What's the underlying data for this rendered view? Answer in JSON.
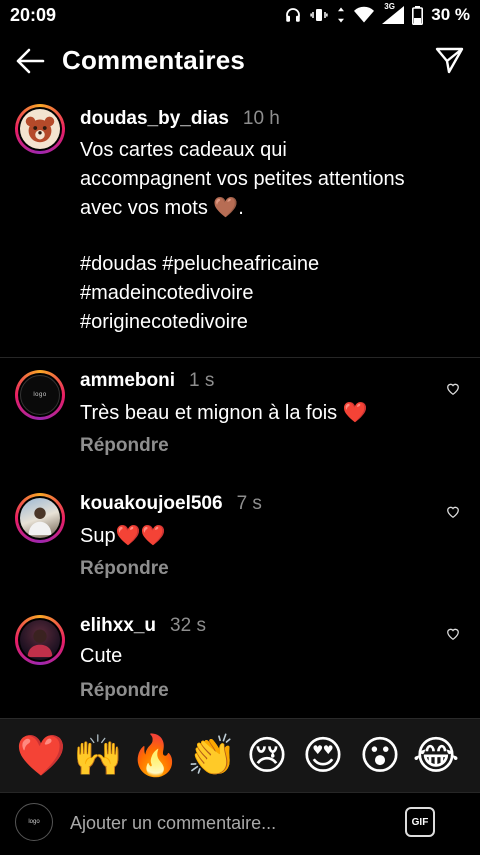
{
  "status_bar": {
    "time": "20:09",
    "battery": "30 %",
    "network": "3G"
  },
  "header": {
    "title": "Commentaires",
    "back_icon": "arrow-left-icon",
    "send_icon": "paper-plane-icon"
  },
  "caption": {
    "username": "doudas_by_dias",
    "time": "10 h",
    "text_lines": [
      "Vos cartes cadeaux qui",
      "accompagnent vos petites attentions",
      "avec vos mots 🤎."
    ],
    "hashtags": [
      "#doudas #pelucheafricaine",
      "#madeincotedivoire",
      "#originecotedivoire"
    ]
  },
  "comments": [
    {
      "username": "ammeboni",
      "time": "1 s",
      "text": "Très beau et mignon à la fois ❤️",
      "reply_label": "Répondre"
    },
    {
      "username": "kouakoujoel506",
      "time": "7 s",
      "text": "Sup❤️❤️",
      "reply_label": "Répondre"
    },
    {
      "username": "elihxx_u",
      "time": "32 s",
      "text": "Cute",
      "reply_label": "Répondre"
    }
  ],
  "reactions": [
    "❤️",
    "🙌",
    "🔥",
    "👏",
    "😢",
    "😍",
    "😮",
    "😂"
  ],
  "input": {
    "placeholder": "Ajouter un commentaire...",
    "gif_label": "GIF"
  },
  "colors": {
    "background": "#000000",
    "muted": "#8e8e8e",
    "reaction_bar": "#161616"
  }
}
